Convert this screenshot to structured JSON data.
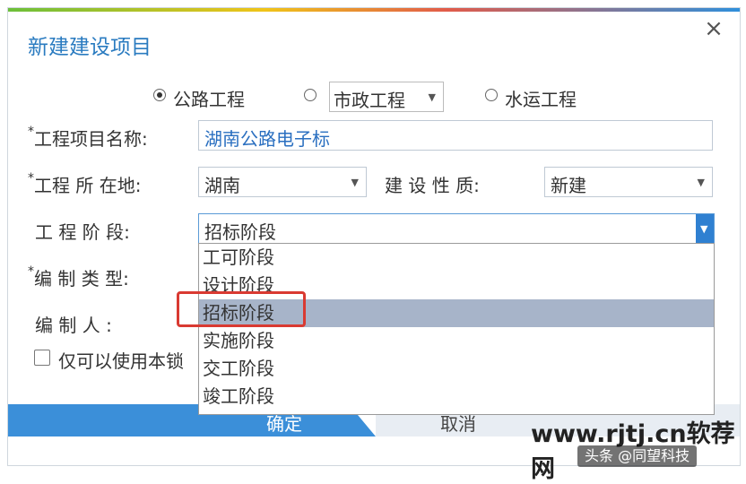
{
  "window": {
    "title": "新建建设项目",
    "close_glyph": "×"
  },
  "project_type": {
    "options": [
      {
        "label": "公路工程",
        "checked": true
      },
      {
        "label": "市政工程",
        "checked": false
      },
      {
        "label": "水运工程",
        "checked": false
      }
    ]
  },
  "form": {
    "name": {
      "label": "工程项目名称:",
      "value": "湖南公路电子标",
      "required_mark": "*"
    },
    "location": {
      "label": "工程 所 在地:",
      "value": "湖南",
      "required_mark": "*"
    },
    "nature": {
      "label": "建 设 性 质:",
      "value": "新建"
    },
    "stage": {
      "label": "工 程  阶 段:",
      "value": "招标阶段",
      "options": [
        "工可阶段",
        "设计阶段",
        "招标阶段",
        "实施阶段",
        "交工阶段",
        "竣工阶段"
      ],
      "selected_index": 2
    },
    "compile_type": {
      "label": "编 制  类 型:",
      "required_mark": "*"
    },
    "compiler": {
      "label": "编  制  人  :"
    },
    "only_use": {
      "label": "仅可以使用本锁",
      "checked": false
    }
  },
  "buttons": {
    "ok": "确定",
    "cancel": "取消"
  },
  "watermark": {
    "site": "www.rjtj.cn软荐网",
    "badge": "头条 @同望科技"
  },
  "colors": {
    "accent": "#2f80d1",
    "title": "#2a7bc0",
    "selection": "#a7b4c9",
    "highlight": "#d93a32"
  }
}
